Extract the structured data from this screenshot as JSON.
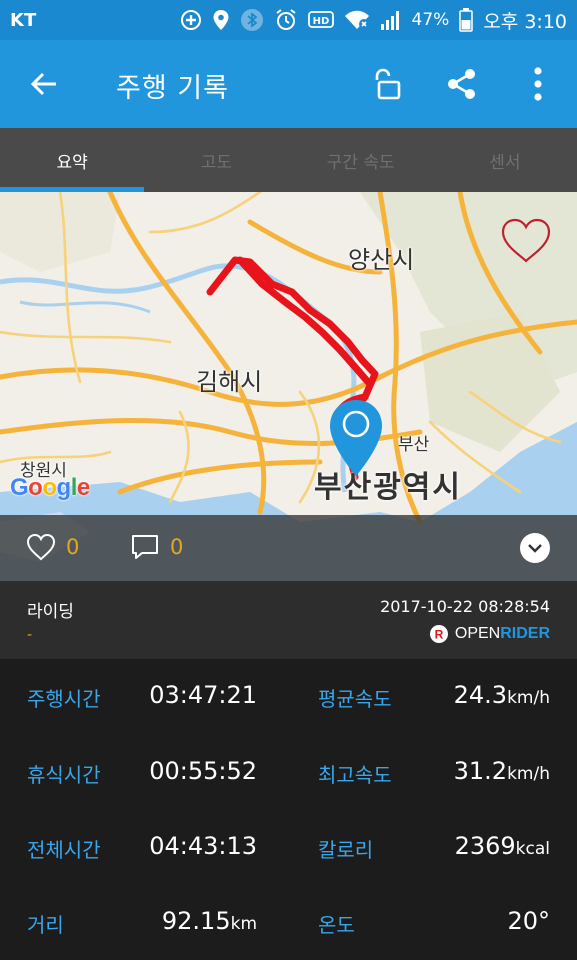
{
  "status_bar": {
    "carrier": "KT",
    "battery": "47%",
    "time": "오후 3:10",
    "icons": [
      "gps-plus-icon",
      "location-icon",
      "bluetooth-icon",
      "alarm-icon",
      "hd-icon",
      "wifi-icon",
      "signal-icon",
      "battery-icon"
    ]
  },
  "app_bar": {
    "title": "주행 기록",
    "icons": [
      "back-arrow-icon",
      "unlock-icon",
      "share-icon",
      "more-vert-icon"
    ]
  },
  "tabs": [
    {
      "label": "요약",
      "active": true
    },
    {
      "label": "고도",
      "active": false
    },
    {
      "label": "구간 속도",
      "active": false
    },
    {
      "label": "센서",
      "active": false
    }
  ],
  "map": {
    "labels": {
      "yangsan": "양산시",
      "gimhae": "김해시",
      "busan_small": "부산",
      "busan_metro": "부산광역시",
      "changwon": "창원시"
    },
    "google_logo": "Google",
    "route_color": "#e8141c",
    "pin_color": "#2196dd"
  },
  "social": {
    "likes": "0",
    "comments": "0"
  },
  "ride": {
    "type": "라이딩",
    "desc": "-",
    "datetime": "2017-10-22 08:28:54",
    "brand_open": "OPEN",
    "brand_rider": "RIDER"
  },
  "stats": {
    "ride_time_label": "주행시간",
    "ride_time": "03:47:21",
    "avg_speed_label": "평균속도",
    "avg_speed": "24.3",
    "avg_speed_unit": "km/h",
    "rest_time_label": "휴식시간",
    "rest_time": "00:55:52",
    "max_speed_label": "최고속도",
    "max_speed": "31.2",
    "max_speed_unit": "km/h",
    "total_time_label": "전체시간",
    "total_time": "04:43:13",
    "calories_label": "칼로리",
    "calories": "2369",
    "calories_unit": "kcal",
    "distance_label": "거리",
    "distance": "92.15",
    "distance_unit": "km",
    "temp_label": "온도",
    "temp": "20°"
  },
  "colors": {
    "primary": "#2196dd",
    "status_bar": "#1b89cf",
    "accent": "#e5a81b",
    "label": "#3aa5e8"
  }
}
